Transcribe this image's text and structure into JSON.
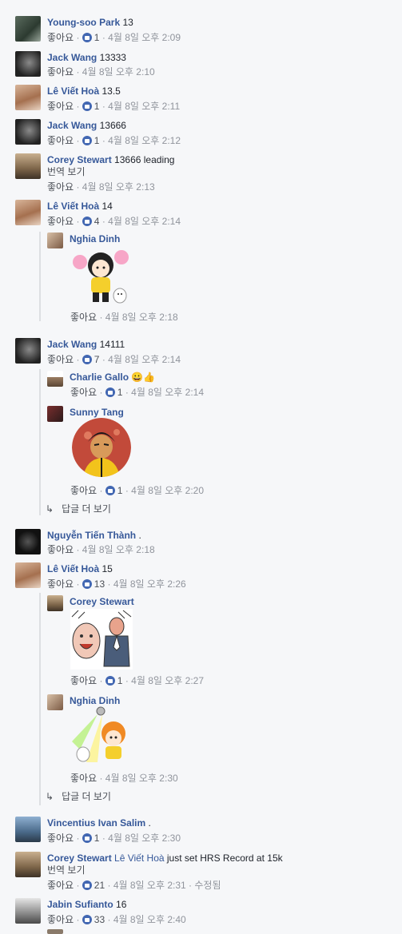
{
  "like": "좋아요",
  "translate": "번역 보기",
  "more_replies": "답글 더 보기",
  "comments": [
    {
      "name": "Young-soo Park",
      "text": "13",
      "likes": "1",
      "time": "4월 8일 오후 2:09"
    },
    {
      "name": "Jack Wang",
      "text": "13333",
      "likes": "",
      "time": "4월 8일 오후 2:10"
    },
    {
      "name": "Lê Viết Hoà",
      "text": "13.5",
      "likes": "1",
      "time": "4월 8일 오후 2:11"
    },
    {
      "name": "Jack Wang",
      "text": "13666",
      "likes": "1",
      "time": "4월 8일 오후 2:12"
    },
    {
      "name": "Corey Stewart",
      "text": "13666 leading",
      "likes": "",
      "time": "4월 8일 오후 2:13"
    },
    {
      "name": "Lê Viết Hoà",
      "text": "14",
      "likes": "4",
      "time": "4월 8일 오후 2:14"
    },
    {
      "name": "Nghia Dinh",
      "text": "",
      "likes": "",
      "time": "4월 8일 오후 2:18"
    },
    {
      "name": "Jack Wang",
      "text": "14111",
      "likes": "7",
      "time": "4월 8일 오후 2:14"
    },
    {
      "name": "Charlie Gallo",
      "text": "😀👍",
      "likes": "1",
      "time": "4월 8일 오후 2:14"
    },
    {
      "name": "Sunny Tang",
      "text": "",
      "likes": "1",
      "time": "4월 8일 오후 2:20"
    },
    {
      "name": "Nguyễn Tiến Thành",
      "text": ".",
      "likes": "",
      "time": "4월 8일 오후 2:18"
    },
    {
      "name": "Lê Viết Hoà",
      "text": "15",
      "likes": "13",
      "time": "4월 8일 오후 2:26"
    },
    {
      "name": "Corey Stewart",
      "text": "",
      "likes": "1",
      "time": "4월 8일 오후 2:27"
    },
    {
      "name": "Nghia Dinh",
      "text": "",
      "likes": "",
      "time": "4월 8일 오후 2:30"
    },
    {
      "name": "Vincentius Ivan Salim",
      "text": ".",
      "likes": "1",
      "time": "4월 8일 오후 2:30"
    },
    {
      "name": "Corey Stewart",
      "tag": "Lê Viết Hoà",
      "text": "just set HRS Record at 15k",
      "likes": "21",
      "time": "4월 8일 오후 2:31",
      "edited": "수정됨"
    },
    {
      "name": "Jabin Sufianto",
      "text": "16",
      "likes": "33",
      "time": "4월 8일 오후 2:40"
    }
  ]
}
